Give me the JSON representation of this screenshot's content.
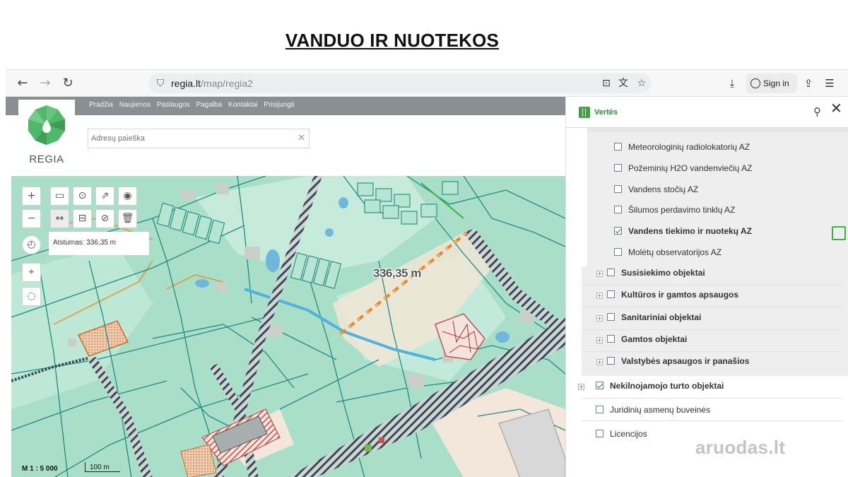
{
  "slide": {
    "title": "VANDUO IR NUOTEKOS"
  },
  "browser": {
    "url_host": "regia.lt",
    "url_path": "/map/regia2",
    "sign_in": "Sign in"
  },
  "site": {
    "logo_text": "REGIA",
    "nav": [
      "Pradžia",
      "Naujienos",
      "Paslaugos",
      "Pagalba",
      "Kontaktai",
      "Prisijungti"
    ],
    "search_placeholder": "Adresų paieška"
  },
  "map": {
    "distance_text": "Atstumas: 336,35 m",
    "measure_label": "336,35 m",
    "scale_text": "M 1 : 5 000",
    "scale_bar": "100 m"
  },
  "panel": {
    "title": "Vertės",
    "sublayers": [
      {
        "label": "Meteorologinių radiolokatorių AZ",
        "checked": false
      },
      {
        "label": "Požeminių H2O vandenviečių AZ",
        "checked": false
      },
      {
        "label": "Vandens stočių AZ",
        "checked": false
      },
      {
        "label": "Šilumos perdavimo tinklų AZ",
        "checked": false
      },
      {
        "label": "Vandens tiekimo ir nuotekų AZ",
        "checked": true
      },
      {
        "label": "Molėtų observatorijos AZ",
        "checked": false
      }
    ],
    "groups": [
      {
        "label": "Susisiekimo objektai",
        "checked": false
      },
      {
        "label": "Kultūros ir gamtos apsaugos",
        "checked": false
      },
      {
        "label": "Sanitariniai objektai",
        "checked": false
      },
      {
        "label": "Gamtos objektai",
        "checked": false
      },
      {
        "label": "Valstybės apsaugos ir panašios",
        "checked": false
      }
    ],
    "top_layers": [
      {
        "label": "Nekilnojamojo turto objektai",
        "checked": true
      },
      {
        "label": "Juridinių asmenų buveinės",
        "checked": false
      },
      {
        "label": "Licencijos",
        "checked": false
      }
    ]
  },
  "watermark": {
    "text": "aruodas",
    "suffix": ".lt"
  },
  "colors": {
    "accent_green": "#3da23f",
    "map_bg": "#a9dfc8",
    "parcel_line": "#1f8a84",
    "road_stripe": "#3b4a55",
    "measure": "#f5821f"
  }
}
